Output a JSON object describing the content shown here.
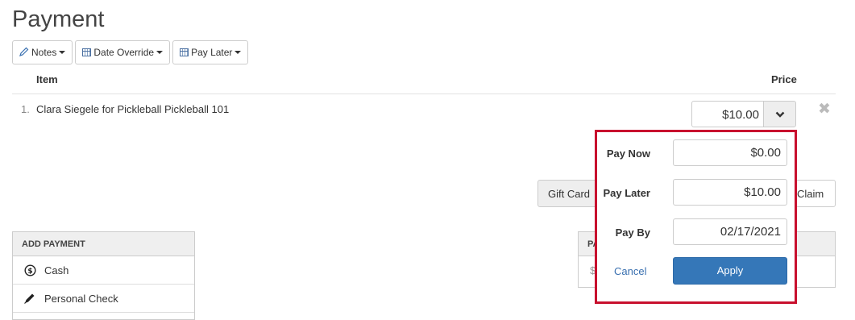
{
  "page": {
    "title": "Payment"
  },
  "toolbar": {
    "notes": {
      "label": "Notes",
      "icon": "pencil-icon"
    },
    "date_override": {
      "label": "Date Override",
      "icon": "calendar-icon"
    },
    "pay_later": {
      "label": "Pay Later",
      "icon": "calendar-icon"
    }
  },
  "table": {
    "headers": {
      "item": "Item",
      "price": "Price"
    },
    "rows": [
      {
        "num": "1.",
        "description": "Clara Siegele for Pickleball Pickleball 101",
        "price": "$10.00"
      }
    ]
  },
  "buttons": {
    "gift_card": "Gift Card",
    "claim": "Claim"
  },
  "add_payment": {
    "header": "ADD PAYMENT",
    "items": [
      {
        "label": "Cash",
        "icon": "dollar-circle-icon"
      },
      {
        "label": "Personal Check",
        "icon": "pen-icon"
      }
    ]
  },
  "right_panel": {
    "header": "PA",
    "body": "$"
  },
  "popover": {
    "pay_now_label": "Pay Now",
    "pay_now_value": "$0.00",
    "pay_later_label": "Pay Later",
    "pay_later_value": "$10.00",
    "pay_by_label": "Pay By",
    "pay_by_value": "02/17/2021",
    "cancel": "Cancel",
    "apply": "Apply"
  },
  "colors": {
    "accent": "#3577b8",
    "highlight_border": "#c8102e"
  }
}
